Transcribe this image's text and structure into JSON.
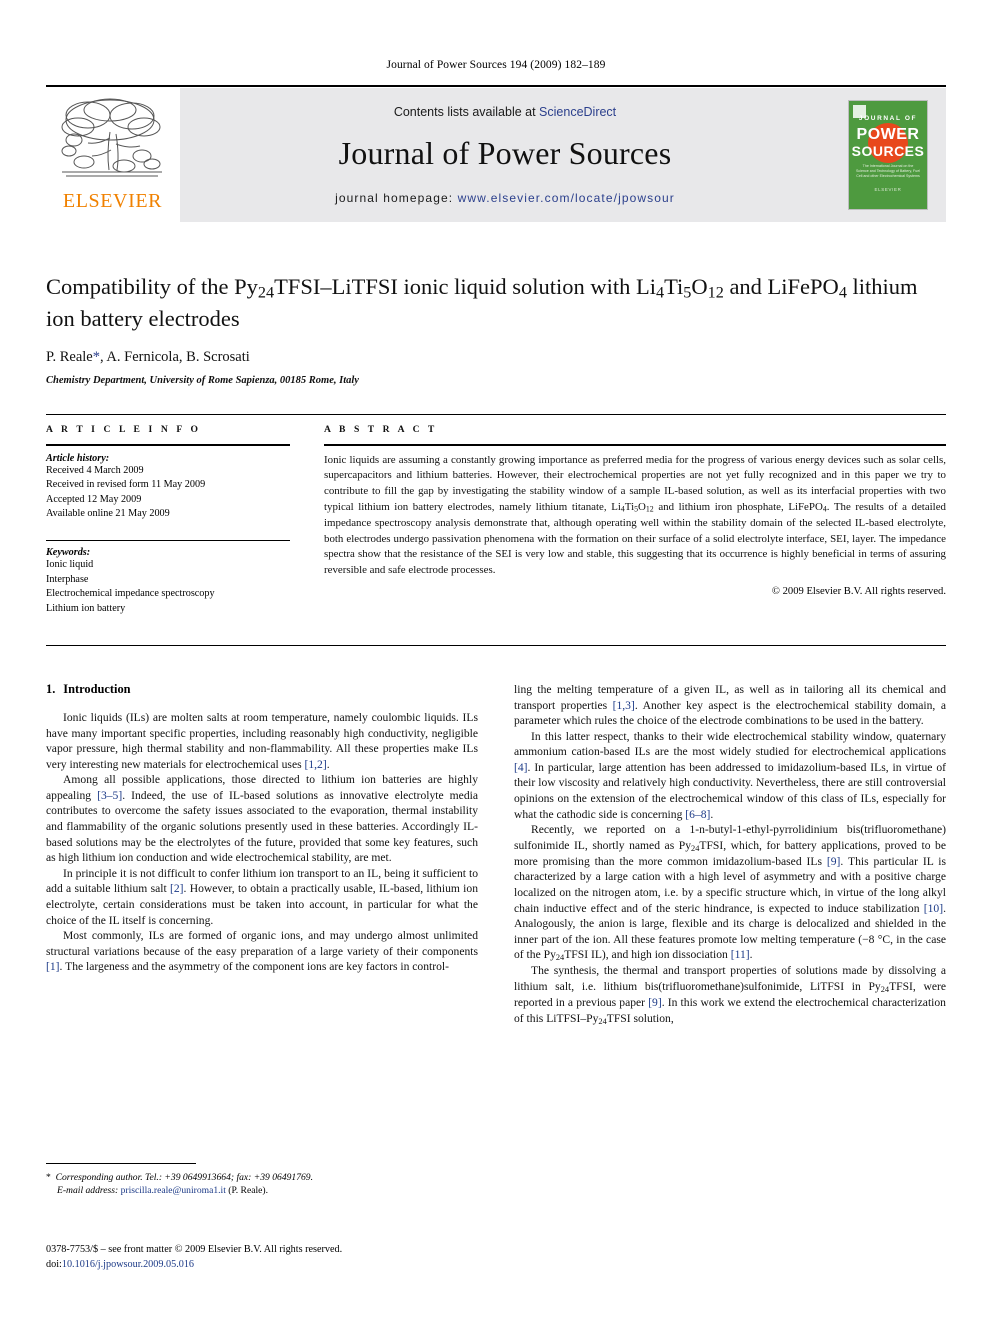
{
  "running_head": "Journal of Power Sources 194 (2009) 182–189",
  "masthead": {
    "contents_prefix": "Contents lists available at ",
    "sciencedirect": "ScienceDirect",
    "journal_title": "Journal of Power Sources",
    "homepage_prefix": "journal homepage: ",
    "homepage_url": "www.elsevier.com/locate/jpowsour",
    "publisher_name": "ELSEVIER",
    "publisher_logo_icon": "elsevier-tree-icon",
    "accent_orange": "#f08100",
    "link_blue": "#2b3f8c",
    "panel_gray": "#e8e8ea"
  },
  "cover": {
    "journal_of": "JOURNAL OF",
    "power": "POWER",
    "sources": "SOURCES",
    "subtitle": "The International Journal on the Science and Technology of Battery, Fuel Cell and other Electrochemical Systems",
    "footer": "ELSEVIER",
    "bg_green": "#4e9a3f",
    "circle_red": "#e8481c"
  },
  "article": {
    "title_html": "Compatibility of the Py<sub>24</sub>TFSI–LiTFSI ionic liquid solution with Li<sub>4</sub>Ti<sub>5</sub>O<sub>12</sub> and LiFePO<sub>4</sub> lithium ion battery electrodes",
    "authors_html": "P. Reale<span class=\"star\">*</span>, A. Fernicola, B. Scrosati",
    "affiliation": "Chemistry Department, University of Rome Sapienza, 00185 Rome, Italy"
  },
  "article_info": {
    "heading": "A R T I C L E   I N F O",
    "history_label": "Article history:",
    "history": [
      "Received 4 March 2009",
      "Received in revised form 11 May 2009",
      "Accepted 12 May 2009",
      "Available online 21 May 2009"
    ],
    "keywords_label": "Keywords:",
    "keywords": [
      "Ionic liquid",
      "Interphase",
      "Electrochemical impedance spectroscopy",
      "Lithium ion battery"
    ]
  },
  "abstract": {
    "heading": "A B S T R A C T",
    "text_html": "Ionic liquids are assuming a constantly growing importance as preferred media for the progress of various energy devices such as solar cells, supercapacitors and lithium batteries. However, their electrochemical properties are not yet fully recognized and in this paper we try to contribute to fill the gap by investigating the stability window of a sample IL-based solution, as well as its interfacial properties with two typical lithium ion battery electrodes, namely lithium titanate, Li<sub>4</sub>Ti<sub>5</sub>O<sub>12</sub> and lithium iron phosphate, LiFePO<sub>4</sub>. The results of a detailed impedance spectroscopy analysis demonstrate that, although operating well within the stability domain of the selected IL-based electrolyte, both electrodes undergo passivation phenomena with the formation on their surface of a solid electrolyte interface, SEI, layer. The impedance spectra show that the resistance of the SEI is very low and stable, this suggesting that its occurrence is highly beneficial in terms of assuring reversible and safe electrode processes.",
    "copyright": "© 2009 Elsevier B.V. All rights reserved."
  },
  "body": {
    "section_number": "1.",
    "section_title": "Introduction",
    "left_paragraphs_html": [
      "Ionic liquids (ILs) are molten salts at room temperature, namely coulombic liquids. ILs have many important specific properties, including reasonably high conductivity, negligible vapor pressure, high thermal stability and non-flammability. All these properties make ILs very interesting new materials for electrochemical uses <span class=\"cite\">[1,2]</span>.",
      "Among all possible applications, those directed to lithium ion batteries are highly appealing <span class=\"cite\">[3–5]</span>. Indeed, the use of IL-based solutions as innovative electrolyte media contributes to overcome the safety issues associated to the evaporation, thermal instability and flammability of the organic solutions presently used in these batteries. Accordingly IL-based solutions may be the electrolytes of the future, provided that some key features, such as high lithium ion conduction and wide electrochemical stability, are met.",
      "In principle it is not difficult to confer lithium ion transport to an IL, being it sufficient to add a suitable lithium salt <span class=\"cite\">[2]</span>. However, to obtain a practically usable, IL-based, lithium ion electrolyte, certain considerations must be taken into account, in particular for what the choice of the IL itself is concerning.",
      "Most commonly, ILs are formed of organic ions, and may undergo almost unlimited structural variations because of the easy preparation of a large variety of their components <span class=\"cite\">[1]</span>. The largeness and the asymmetry of the component ions are key factors in control-"
    ],
    "right_paragraphs_html": [
      "ling the melting temperature of a given IL, as well as in tailoring all its chemical and transport properties <span class=\"cite\">[1,3]</span>. Another key aspect is the electrochemical stability domain, a parameter which rules the choice of the electrode combinations to be used in the battery.",
      "In this latter respect, thanks to their wide electrochemical stability window, quaternary ammonium cation-based ILs are the most widely studied for electrochemical applications <span class=\"cite\">[4]</span>. In particular, large attention has been addressed to imidazolium-based ILs, in virtue of their low viscosity and relatively high conductivity. Nevertheless, there are still controversial opinions on the extension of the electrochemical window of this class of ILs, especially for what the cathodic side is concerning <span class=\"cite\">[6–8]</span>.",
      "Recently, we reported on a 1-n-butyl-1-ethyl-pyrrolidinium bis(trifluoromethane) sulfonimide IL, shortly named as Py<sub>24</sub>TFSI, which, for battery applications, proved to be more promising than the more common imidazolium-based ILs <span class=\"cite\">[9]</span>. This particular IL is characterized by a large cation with a high level of asymmetry and with a positive charge localized on the nitrogen atom, i.e. by a specific structure which, in virtue of the long alkyl chain inductive effect and of the steric hindrance, is expected to induce stabilization <span class=\"cite\">[10]</span>. Analogously, the anion is large, flexible and its charge is delocalized and shielded in the inner part of the ion. All these features promote low melting temperature (−8 °C, in the case of the Py<sub>24</sub>TFSI IL), and high ion dissociation <span class=\"cite\">[11]</span>.",
      "The synthesis, the thermal and transport properties of solutions made by dissolving a lithium salt, i.e. lithium bis(trifluoromethane)sulfonimide, LiTFSI in Py<sub>24</sub>TFSI, were reported in a previous paper <span class=\"cite\">[9]</span>. In this work we extend the electrochemical characterization of this LiTFSI–Py<sub>24</sub>TFSI solution,"
    ]
  },
  "footnotes": {
    "corresponding_html": "<span class=\"fn-star\">*</span>&nbsp; <i>Corresponding author. Tel.: +39 0649913664; fax: +39 06491769.</i>",
    "email_html": "<i>E-mail address:</i> <span class=\"mail\">priscilla.reale@uniroma1.it</span> (P. Reale)."
  },
  "imprint": {
    "issn_line": "0378-7753/$ – see front matter © 2009 Elsevier B.V. All rights reserved.",
    "doi_label": "doi:",
    "doi_value": "10.1016/j.jpowsour.2009.05.016"
  }
}
